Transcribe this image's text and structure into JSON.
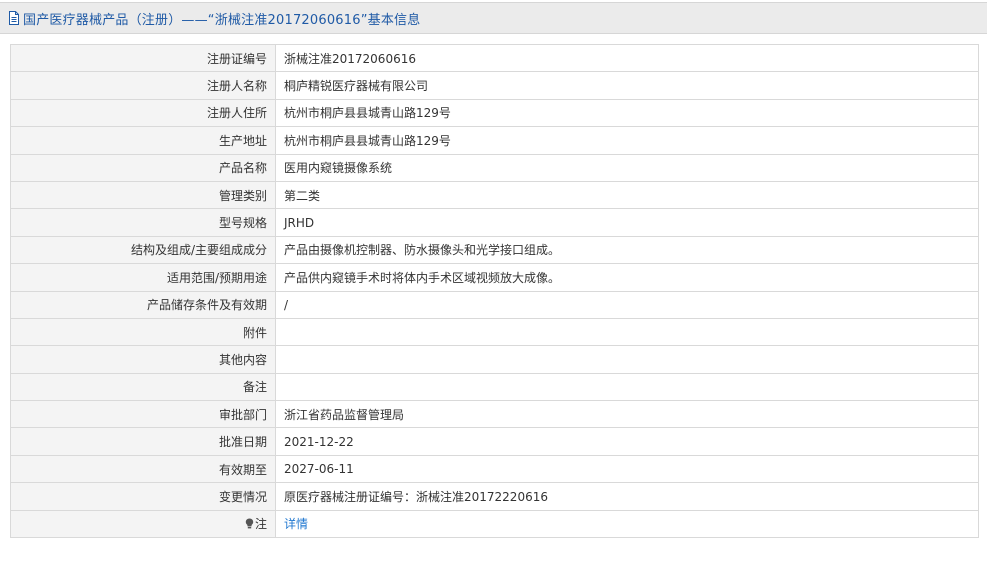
{
  "header": {
    "title": "国产医疗器械产品（注册）——“浙械注准20172060616”基本信息",
    "icon": "document-icon"
  },
  "rows": [
    {
      "label": "注册证编号",
      "value": "浙械注准20172060616"
    },
    {
      "label": "注册人名称",
      "value": "桐庐精锐医疗器械有限公司"
    },
    {
      "label": "注册人住所",
      "value": "杭州市桐庐县县城青山路129号"
    },
    {
      "label": "生产地址",
      "value": "杭州市桐庐县县城青山路129号"
    },
    {
      "label": "产品名称",
      "value": "医用内窥镜摄像系统"
    },
    {
      "label": "管理类别",
      "value": "第二类"
    },
    {
      "label": "型号规格",
      "value": "JRHD"
    },
    {
      "label": "结构及组成/主要组成成分",
      "value": "产品由摄像机控制器、防水摄像头和光学接口组成。"
    },
    {
      "label": "适用范围/预期用途",
      "value": "产品供内窥镜手术时将体内手术区域视频放大成像。"
    },
    {
      "label": "产品储存条件及有效期",
      "value": "/"
    },
    {
      "label": "附件",
      "value": ""
    },
    {
      "label": "其他内容",
      "value": ""
    },
    {
      "label": "备注",
      "value": ""
    },
    {
      "label": "审批部门",
      "value": "浙江省药品监督管理局"
    },
    {
      "label": "批准日期",
      "value": "2021-12-22"
    },
    {
      "label": "有效期至",
      "value": "2027-06-11"
    },
    {
      "label": "变更情况",
      "value": "原医疗器械注册证编号：浙械注准20172220616"
    }
  ],
  "note_row": {
    "label": "注",
    "icon": "lightbulb-icon",
    "link_text": "详情"
  },
  "colors": {
    "title_text": "#1f5aa6",
    "title_bg": "#ebebeb",
    "label_bg": "#f4f4f4",
    "border": "#d9d9d9",
    "link": "#1f77d0"
  }
}
